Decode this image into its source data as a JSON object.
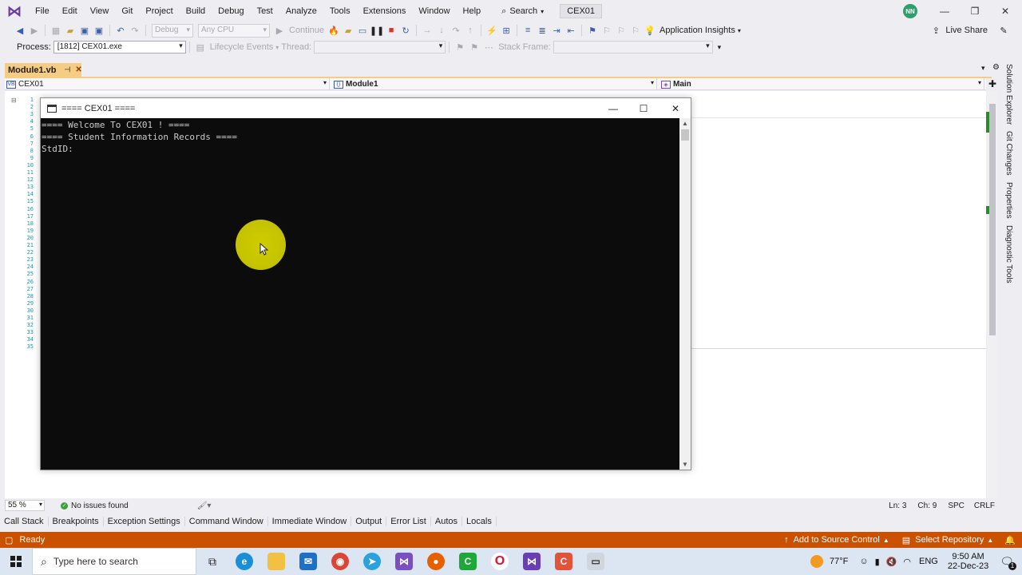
{
  "menubar": {
    "items": [
      "File",
      "Edit",
      "View",
      "Git",
      "Project",
      "Build",
      "Debug",
      "Test",
      "Analyze",
      "Tools",
      "Extensions",
      "Window",
      "Help"
    ],
    "search_label": "Search",
    "solution_name": "CEX01",
    "avatar_initials": "NN"
  },
  "toolbar1": {
    "config": "Debug",
    "platform": "Any CPU",
    "continue_label": "Continue",
    "app_insights": "Application Insights",
    "live_share": "Live Share"
  },
  "toolbar2": {
    "process_label": "Process:",
    "process_value": "[1812] CEX01.exe",
    "lifecycle_label": "Lifecycle Events",
    "thread_label": "Thread:",
    "stack_frame_label": "Stack Frame:"
  },
  "document_tab": {
    "title": "Module1.vb"
  },
  "navbar": {
    "project": "CEX01",
    "type": "Module1",
    "member": "Main"
  },
  "editor": {
    "line_numbers": [
      "1",
      "2",
      "3",
      "4",
      "5",
      "6",
      "7",
      "8",
      "9",
      "10",
      "11",
      "12",
      "13",
      "14",
      "15",
      "16",
      "17",
      "18",
      "19",
      "20",
      "21",
      "22",
      "23",
      "24",
      "25",
      "26",
      "27",
      "28",
      "29",
      "30",
      "31",
      "32",
      "33",
      "34",
      "35"
    ]
  },
  "console": {
    "title": "==== CEX01 ====",
    "lines": [
      "==== Welcome To CEX01 ! ====",
      "==== Student Information Records ====",
      "StdID:"
    ]
  },
  "side_tabs": [
    "Solution Explorer",
    "Git Changes",
    "Properties",
    "Diagnostic Tools"
  ],
  "edstatus": {
    "zoom": "55 %",
    "issues": "No issues found",
    "ln": "Ln: 3",
    "ch": "Ch: 9",
    "spc": "SPC",
    "eol": "CRLF"
  },
  "debug_tabs": [
    "Call Stack",
    "Breakpoints",
    "Exception Settings",
    "Command Window",
    "Immediate Window",
    "Output",
    "Error List",
    "Autos",
    "Locals"
  ],
  "statusbar": {
    "ready": "Ready",
    "source_control": "Add to Source Control",
    "repository": "Select Repository"
  },
  "taskbar": {
    "search_placeholder": "Type here to search",
    "weather": "77°F",
    "lang": "ENG",
    "time": "9:50 AM",
    "date": "22-Dec-23",
    "notification_count": "1"
  },
  "colors": {
    "status_orange": "#ca5100",
    "tab_gold": "#f5cc84",
    "console_bg": "#0c0c0c",
    "cursor_yellow": "#dedb00"
  }
}
